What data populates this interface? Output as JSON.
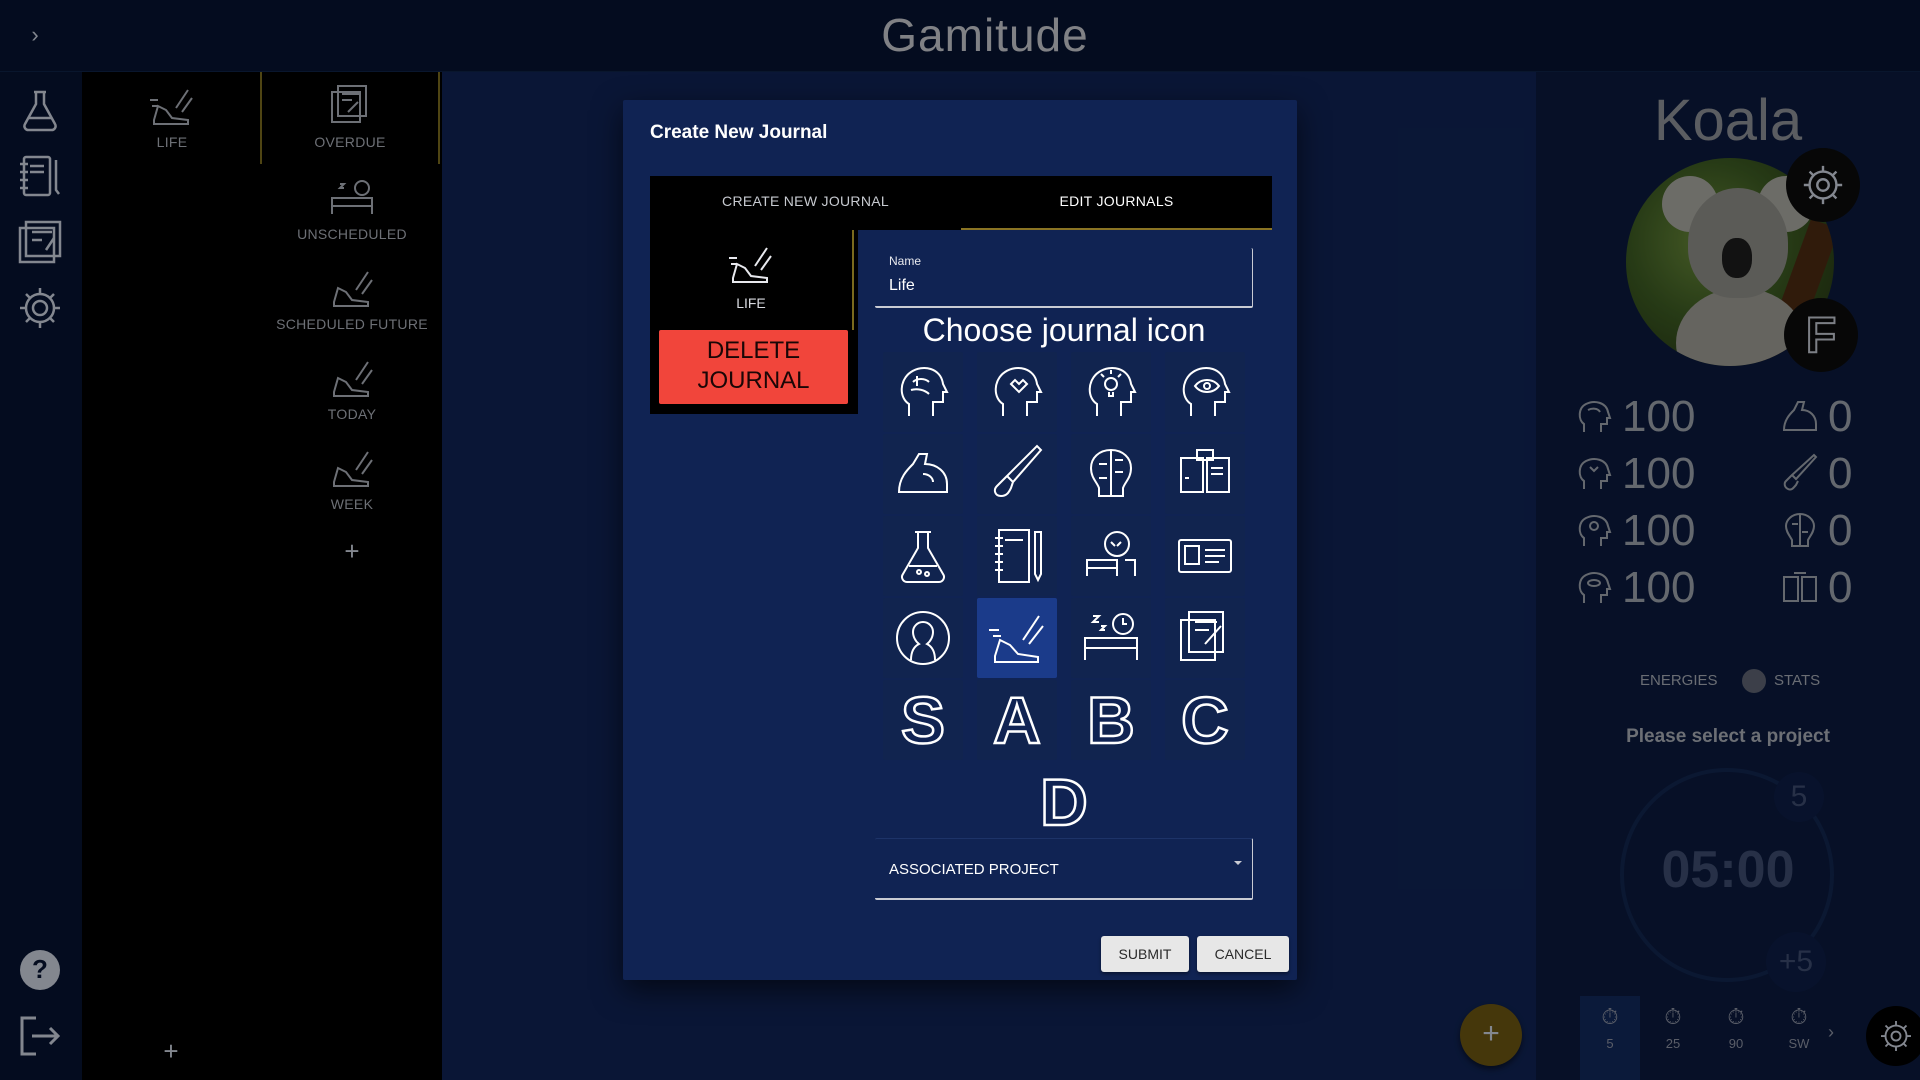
{
  "app": {
    "title": "Gamitude",
    "expand_icon": "chevron-right-icon"
  },
  "leftbar": {
    "items": [
      "flask-icon",
      "notebook-icon",
      "planner-icon",
      "gear-icon"
    ],
    "bottom": [
      "help-icon",
      "logout-icon"
    ]
  },
  "journals": [
    {
      "label": "LIFE",
      "icon": "running-shoe-icon"
    },
    {
      "label": "OVERDUE",
      "icon": "checklist-icon"
    },
    {
      "label": "UNSCHEDULED",
      "icon": "sleep-icon"
    },
    {
      "label": "SCHEDULED FUTURE",
      "icon": "running-shoe-icon"
    },
    {
      "label": "TODAY",
      "icon": "running-shoe-icon"
    },
    {
      "label": "WEEK",
      "icon": "running-shoe-icon"
    }
  ],
  "add_symbol": "+",
  "profile": {
    "name": "Koala",
    "rank": "F",
    "energies": [
      {
        "icon": "brain-head-icon",
        "value": "100"
      },
      {
        "icon": "heart-head-icon",
        "value": "100"
      },
      {
        "icon": "idea-head-icon",
        "value": "100"
      },
      {
        "icon": "eye-head-icon",
        "value": "100"
      }
    ],
    "stats": [
      {
        "icon": "muscle-icon",
        "value": "0"
      },
      {
        "icon": "brush-icon",
        "value": "0"
      },
      {
        "icon": "brain-circuit-icon",
        "value": "0"
      },
      {
        "icon": "book-icon",
        "value": "0"
      }
    ],
    "toggle_left": "ENERGIES",
    "toggle_right": "STATS",
    "select_project": "Please select a project",
    "timer": "05:00",
    "timer_minus": "5",
    "timer_plus": "+5",
    "timer_tabs": [
      "5",
      "25",
      "90",
      "SW"
    ]
  },
  "dialog": {
    "title": "Create New Journal",
    "tab_create": "CREATE NEW JOURNAL",
    "tab_edit": "EDIT JOURNALS",
    "selected_journal": "LIFE",
    "delete_line1": "DELETE",
    "delete_line2": "JOURNAL",
    "name_label": "Name",
    "name_value": "Life",
    "choose_icon_title": "Choose journal icon",
    "letters": [
      "S",
      "A",
      "B",
      "C",
      "D"
    ],
    "associated_project": "ASSOCIATED PROJECT",
    "submit": "SUBMIT",
    "cancel": "CANCEL",
    "selected_icon": "running-shoe-icon"
  }
}
